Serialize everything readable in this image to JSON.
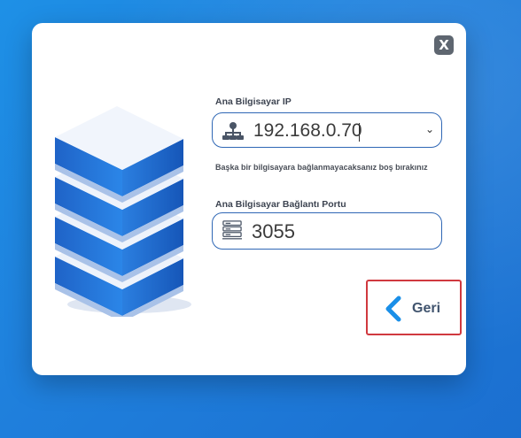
{
  "dialog": {
    "close_label": "X",
    "host_ip_label": "Ana Bilgisayar IP",
    "host_ip_value": "192.168.0.70",
    "host_ip_hint": "Başka bir bilgisayara bağlanmayacaksanız boş bırakınız",
    "port_label": "Ana Bilgisayar Bağlantı Portu",
    "port_value": "3055",
    "back_label": "Geri"
  },
  "icons": {
    "host_ip": "network-icon",
    "port": "server-rack-icon",
    "back": "chevron-left-icon",
    "illustration": "server-stack-illustration"
  },
  "colors": {
    "background": "#1e88e5",
    "field_border": "#2f67b5",
    "back_border": "#d0393f",
    "accent": "#1a8fe8"
  }
}
